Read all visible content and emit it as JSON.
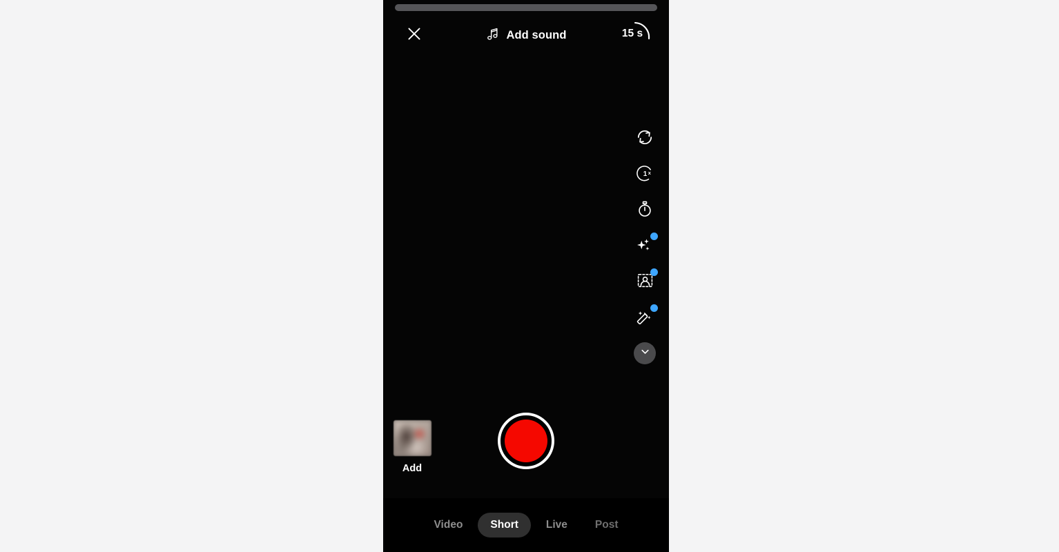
{
  "app": {
    "name": "YouTube Shorts Camera",
    "screen_background": "#050505",
    "page_background": "#f4f4f5",
    "accent_record": "#f50800",
    "accent_badge": "#3ea6ff"
  },
  "progress": {
    "name": "recording-progress",
    "percent": 0,
    "track_color": "#555558",
    "fill_color": "#ff0000"
  },
  "topbar": {
    "close_label": "Close",
    "close_icon": "close-icon",
    "add_sound": {
      "label": "Add sound",
      "icon": "music-note-icon"
    },
    "timer": {
      "value": "15 s",
      "icon": "duration-arc-icon"
    }
  },
  "tools": [
    {
      "name": "flip-camera",
      "icon": "camera-flip-icon",
      "label": "Flip camera",
      "badge": false
    },
    {
      "name": "speed",
      "icon": "speed-1x-icon",
      "label": "1x",
      "badge": false
    },
    {
      "name": "timer",
      "icon": "stopwatch-icon",
      "label": "Timer",
      "badge": false
    },
    {
      "name": "effects",
      "icon": "sparkles-icon",
      "label": "Effects",
      "badge": true
    },
    {
      "name": "green-screen",
      "icon": "green-screen-icon",
      "label": "Green screen",
      "badge": true
    },
    {
      "name": "retouch",
      "icon": "magic-wand-icon",
      "label": "Retouch",
      "badge": true
    }
  ],
  "tools_expand": {
    "name": "expand-tools",
    "icon": "chevron-down-icon",
    "label": "More options"
  },
  "capture": {
    "gallery": {
      "label": "Add",
      "name": "gallery-add"
    },
    "record": {
      "label": "Record",
      "name": "record-button"
    }
  },
  "modes": {
    "items": [
      {
        "label": "Video",
        "active": false,
        "dim": false
      },
      {
        "label": "Short",
        "active": true,
        "dim": false
      },
      {
        "label": "Live",
        "active": false,
        "dim": false
      },
      {
        "label": "Post",
        "active": false,
        "dim": true
      }
    ],
    "selected": "Short"
  }
}
